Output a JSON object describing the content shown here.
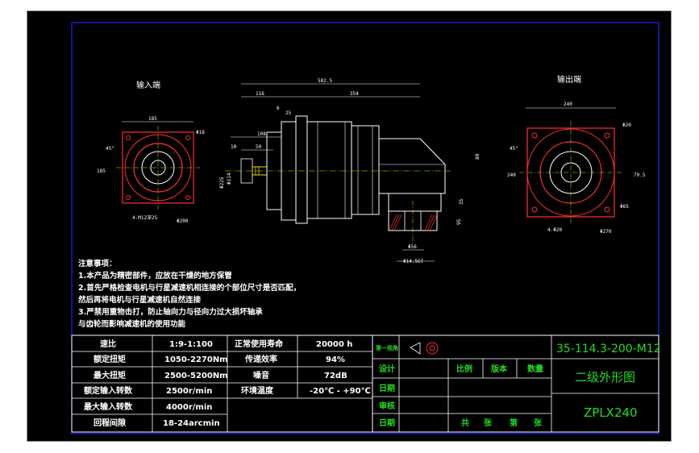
{
  "labels": {
    "input_end": "输入端",
    "output_end": "输出端"
  },
  "dims_left": {
    "top_width": "185",
    "hole_dia": "Φ18",
    "angle": "45°",
    "side": "185",
    "bolt": "4-M12深25",
    "pcd": "Φ200"
  },
  "dims_mid": {
    "overall": "582.5",
    "d116": "116",
    "d354": "354",
    "d6": "6",
    "d25": "25",
    "d108": "108",
    "d10": "10",
    "d50": "50",
    "d114": "Φ114",
    "d225": "Φ225",
    "d80": "80",
    "d35": "35",
    "d95": "95",
    "d56": "Φ56",
    "d14": "14.5",
    "d45": "Φ14.5GT"
  },
  "dims_right": {
    "top_width": "240",
    "hole_dia": "Φ20",
    "angle": "45°",
    "side": "240",
    "d79": "79.5",
    "d65": "Φ65",
    "bolt": "4-Φ20",
    "pcd": "Φ270"
  },
  "notes": {
    "title": "注意事项：",
    "line1": "1.本产品为精密部件，应放在干燥的地方保管",
    "line2": "2.首先严格检查电机与行星减速机相连接的个部位尺寸是否匹配，",
    "line3": "然后再将电机与行星减速机自然连接",
    "line4": "3.严禁用重物击打，防止轴向力与径向力过大损坏轴承",
    "line5": "与齿轮而影响减速机的使用功能"
  },
  "spec_table": [
    {
      "k1": "速比",
      "v1": "1:9-1:100",
      "k2": "正常使用寿命",
      "v2": "20000 h"
    },
    {
      "k1": "额定扭矩",
      "v1": "1050-2270Nm",
      "k2": "传递效率",
      "v2": "94%"
    },
    {
      "k1": "最大扭矩",
      "v1": "2500-5200Nm",
      "k2": "噪音",
      "v2": "72dB"
    },
    {
      "k1": "额定输入转数",
      "v1": "2500r/min",
      "k2": "环境温度",
      "v2": "-20℃ - +90℃"
    },
    {
      "k1": "最大输入转数",
      "v1": "4000r/min",
      "k2": "",
      "v2": ""
    },
    {
      "k1": "回程间隙",
      "v1": "18-24arcmin",
      "k2": "",
      "v2": ""
    }
  ],
  "title_block": {
    "projection": "第一视角",
    "drawing_no": "35-114.3-200-M12",
    "design": "设计",
    "ratio": "比例",
    "version": "版本",
    "quantity": "数量",
    "drawing_name": "二级外形图",
    "date1": "日期",
    "review": "审核",
    "model": "ZPLX240",
    "date2": "日期",
    "total": "共",
    "sheets": "张",
    "page_no": "第",
    "page": "张"
  }
}
